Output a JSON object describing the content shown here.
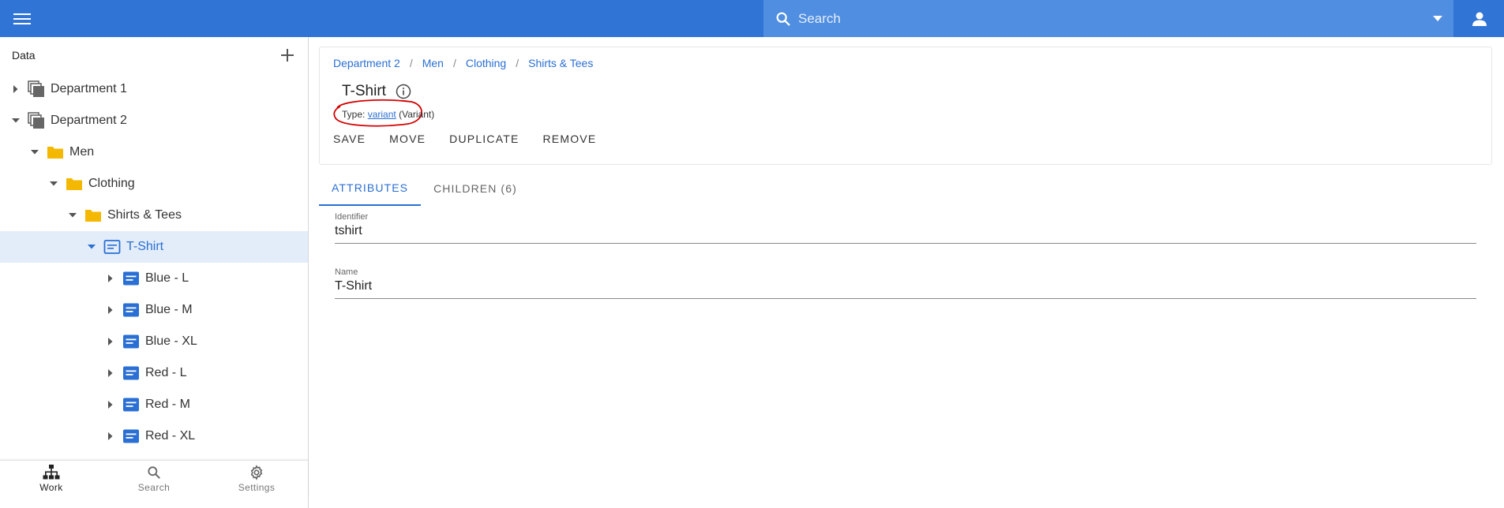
{
  "header": {
    "search_placeholder": "Search"
  },
  "sidebar": {
    "title": "Data",
    "tree": [
      {
        "label": "Department 1",
        "depth": 0,
        "expanded": false,
        "icon": "collection-icon"
      },
      {
        "label": "Department 2",
        "depth": 0,
        "expanded": true,
        "icon": "collection-icon"
      },
      {
        "label": "Men",
        "depth": 1,
        "expanded": true,
        "icon": "folder-icon"
      },
      {
        "label": "Clothing",
        "depth": 2,
        "expanded": true,
        "icon": "folder-icon"
      },
      {
        "label": "Shirts & Tees",
        "depth": 3,
        "expanded": true,
        "icon": "folder-icon"
      },
      {
        "label": "T-Shirt",
        "depth": 4,
        "expanded": true,
        "icon": "variant-icon",
        "selected": true
      },
      {
        "label": "Blue - L",
        "depth": 5,
        "expanded": false,
        "icon": "item-icon"
      },
      {
        "label": "Blue - M",
        "depth": 5,
        "expanded": false,
        "icon": "item-icon"
      },
      {
        "label": "Blue - XL",
        "depth": 5,
        "expanded": false,
        "icon": "item-icon"
      },
      {
        "label": "Red - L",
        "depth": 5,
        "expanded": false,
        "icon": "item-icon"
      },
      {
        "label": "Red - M",
        "depth": 5,
        "expanded": false,
        "icon": "item-icon"
      },
      {
        "label": "Red - XL",
        "depth": 5,
        "expanded": false,
        "icon": "item-icon"
      }
    ],
    "bottom_nav": {
      "work": "Work",
      "search": "Search",
      "settings": "Settings"
    }
  },
  "main": {
    "breadcrumb": [
      "Department 2",
      "Men",
      "Clothing",
      "Shirts & Tees"
    ],
    "title": "T-Shirt",
    "type_prefix": "Type:",
    "type_link": "variant",
    "type_suffix": "(Variant)",
    "actions": {
      "save": "SAVE",
      "move": "MOVE",
      "duplicate": "DUPLICATE",
      "remove": "REMOVE"
    },
    "tabs": {
      "attributes": "ATTRIBUTES",
      "children": "CHILDREN (6)"
    },
    "fields": {
      "identifier_label": "Identifier",
      "identifier_value": "tshirt",
      "name_label": "Name",
      "name_value": "T-Shirt"
    }
  },
  "colors": {
    "appbar": "#3074d6",
    "search_bg": "#4f8ee0",
    "accent": "#2a6fd3",
    "folder": "#f5b800",
    "item_icon": "#2a6fd3",
    "annotation_ring": "#d40000"
  }
}
